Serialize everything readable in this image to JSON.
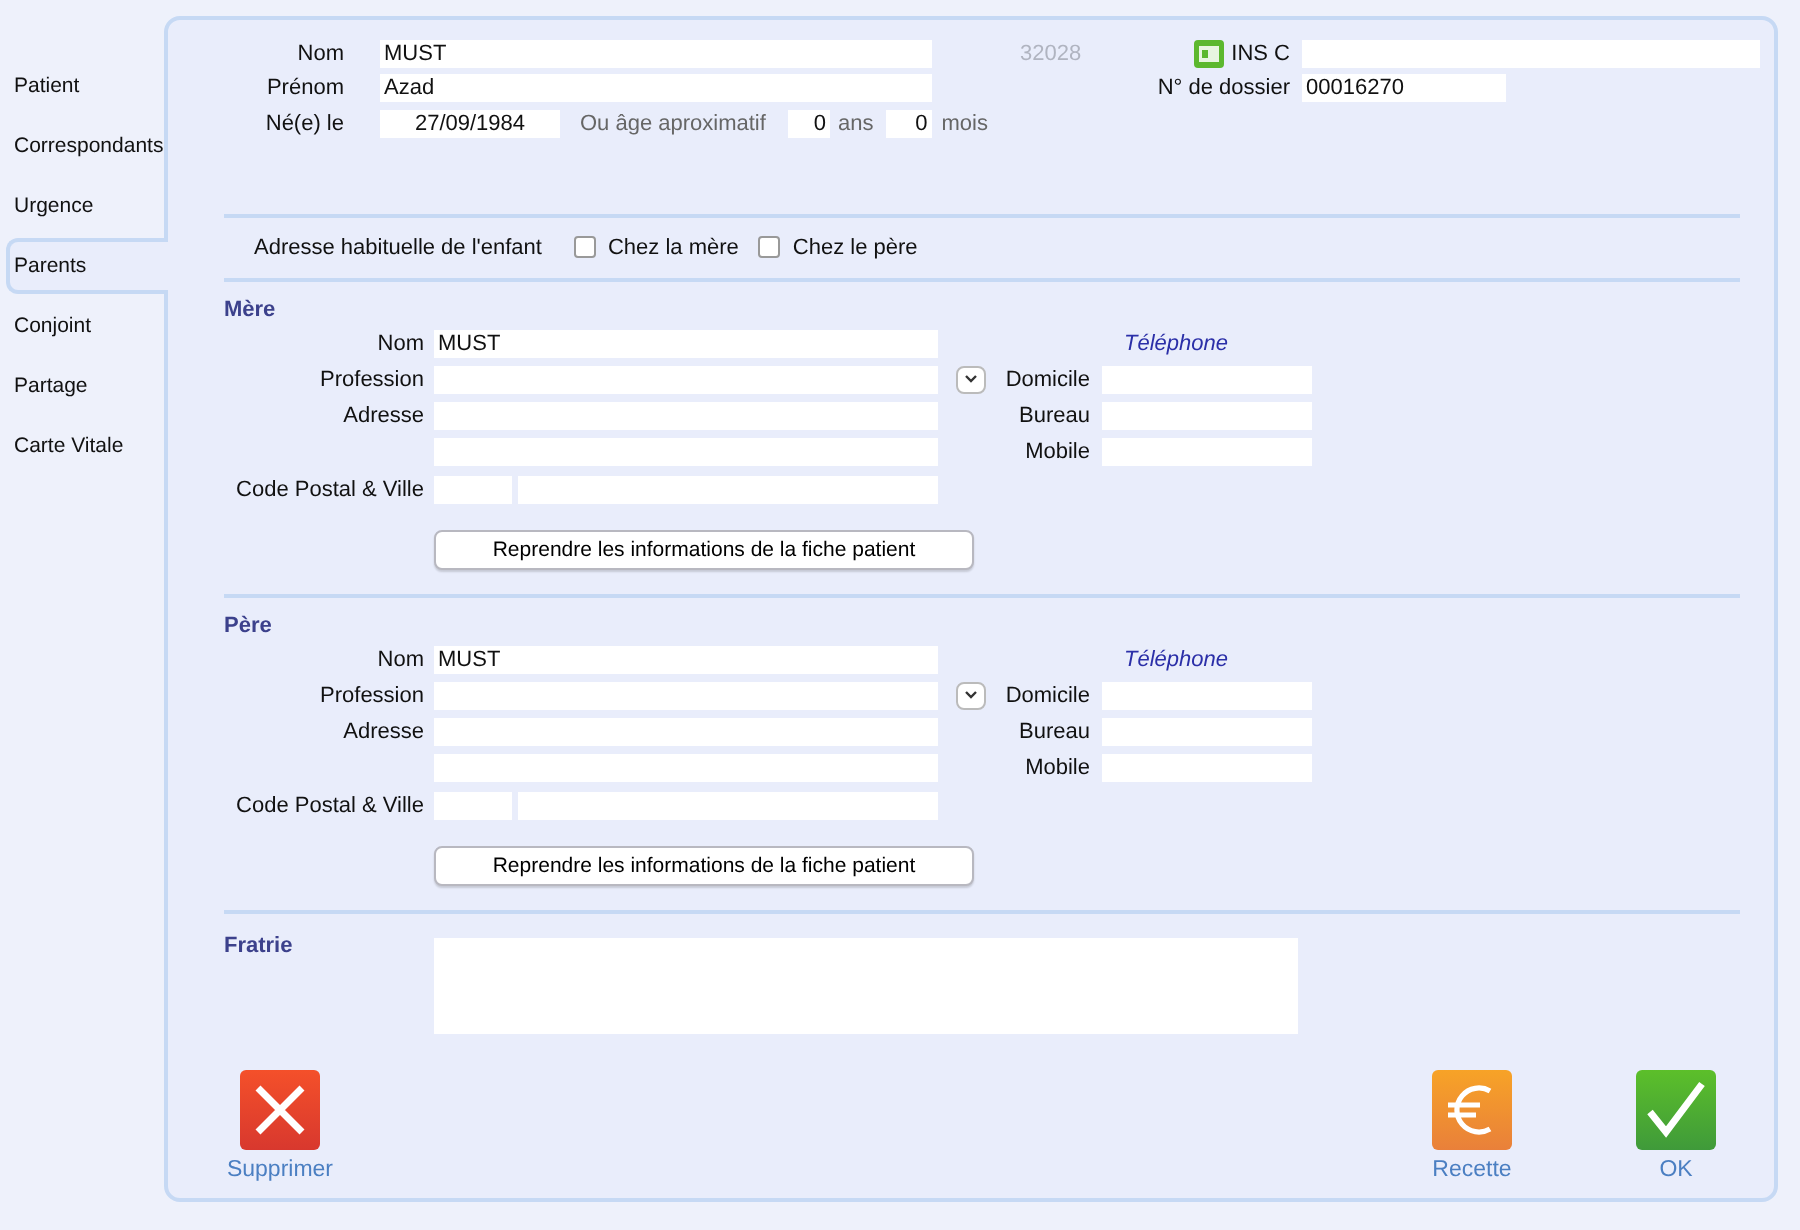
{
  "sidebar": {
    "items": [
      {
        "label": "Patient",
        "selected": false
      },
      {
        "label": "Correspondants",
        "selected": false
      },
      {
        "label": "Urgence",
        "selected": false
      },
      {
        "label": "Parents",
        "selected": true
      },
      {
        "label": "Conjoint",
        "selected": false
      },
      {
        "label": "Partage",
        "selected": false
      },
      {
        "label": "Carte Vitale",
        "selected": false
      }
    ]
  },
  "patient": {
    "nom": {
      "label": "Nom",
      "value": "MUST"
    },
    "number": "32028",
    "ins": {
      "label": "INS C"
    },
    "prenom": {
      "label": "Prénom",
      "value": "Azad"
    },
    "dossier": {
      "label": "N° de dossier",
      "value": "00016270"
    },
    "naissance": {
      "label": "Né(e) le",
      "value": "27/09/1984"
    },
    "age_label": "Ou âge aproximatif",
    "age_years": {
      "value": "0",
      "unit": "ans"
    },
    "age_months": {
      "value": "0",
      "unit": "mois"
    }
  },
  "adresse_habituelle": {
    "label": "Adresse habituelle de l'enfant",
    "options": [
      {
        "label": "Chez la mère",
        "checked": false
      },
      {
        "label": "Chez le père",
        "checked": false
      }
    ]
  },
  "parents": [
    {
      "title": "Mère",
      "nom": {
        "label": "Nom",
        "value": "MUST"
      },
      "profession": {
        "label": "Profession"
      },
      "adresse": {
        "label": "Adresse"
      },
      "code_postal_ville": {
        "label": "Code Postal & Ville"
      },
      "phone_heading": "Téléphone",
      "phones": [
        {
          "label": "Domicile"
        },
        {
          "label": "Bureau"
        },
        {
          "label": "Mobile"
        }
      ],
      "button": "Reprendre les informations de la fiche patient"
    },
    {
      "title": "Père",
      "nom": {
        "label": "Nom",
        "value": "MUST"
      },
      "profession": {
        "label": "Profession"
      },
      "adresse": {
        "label": "Adresse"
      },
      "code_postal_ville": {
        "label": "Code Postal & Ville"
      },
      "phone_heading": "Téléphone",
      "phones": [
        {
          "label": "Domicile"
        },
        {
          "label": "Bureau"
        },
        {
          "label": "Mobile"
        }
      ],
      "button": "Reprendre les informations de la fiche patient"
    }
  ],
  "fratrie": {
    "title": "Fratrie"
  },
  "actions": [
    {
      "kind": "delete",
      "label": "Supprimer"
    },
    {
      "kind": "payment",
      "label": "Recette"
    },
    {
      "kind": "ok",
      "label": "OK"
    }
  ]
}
